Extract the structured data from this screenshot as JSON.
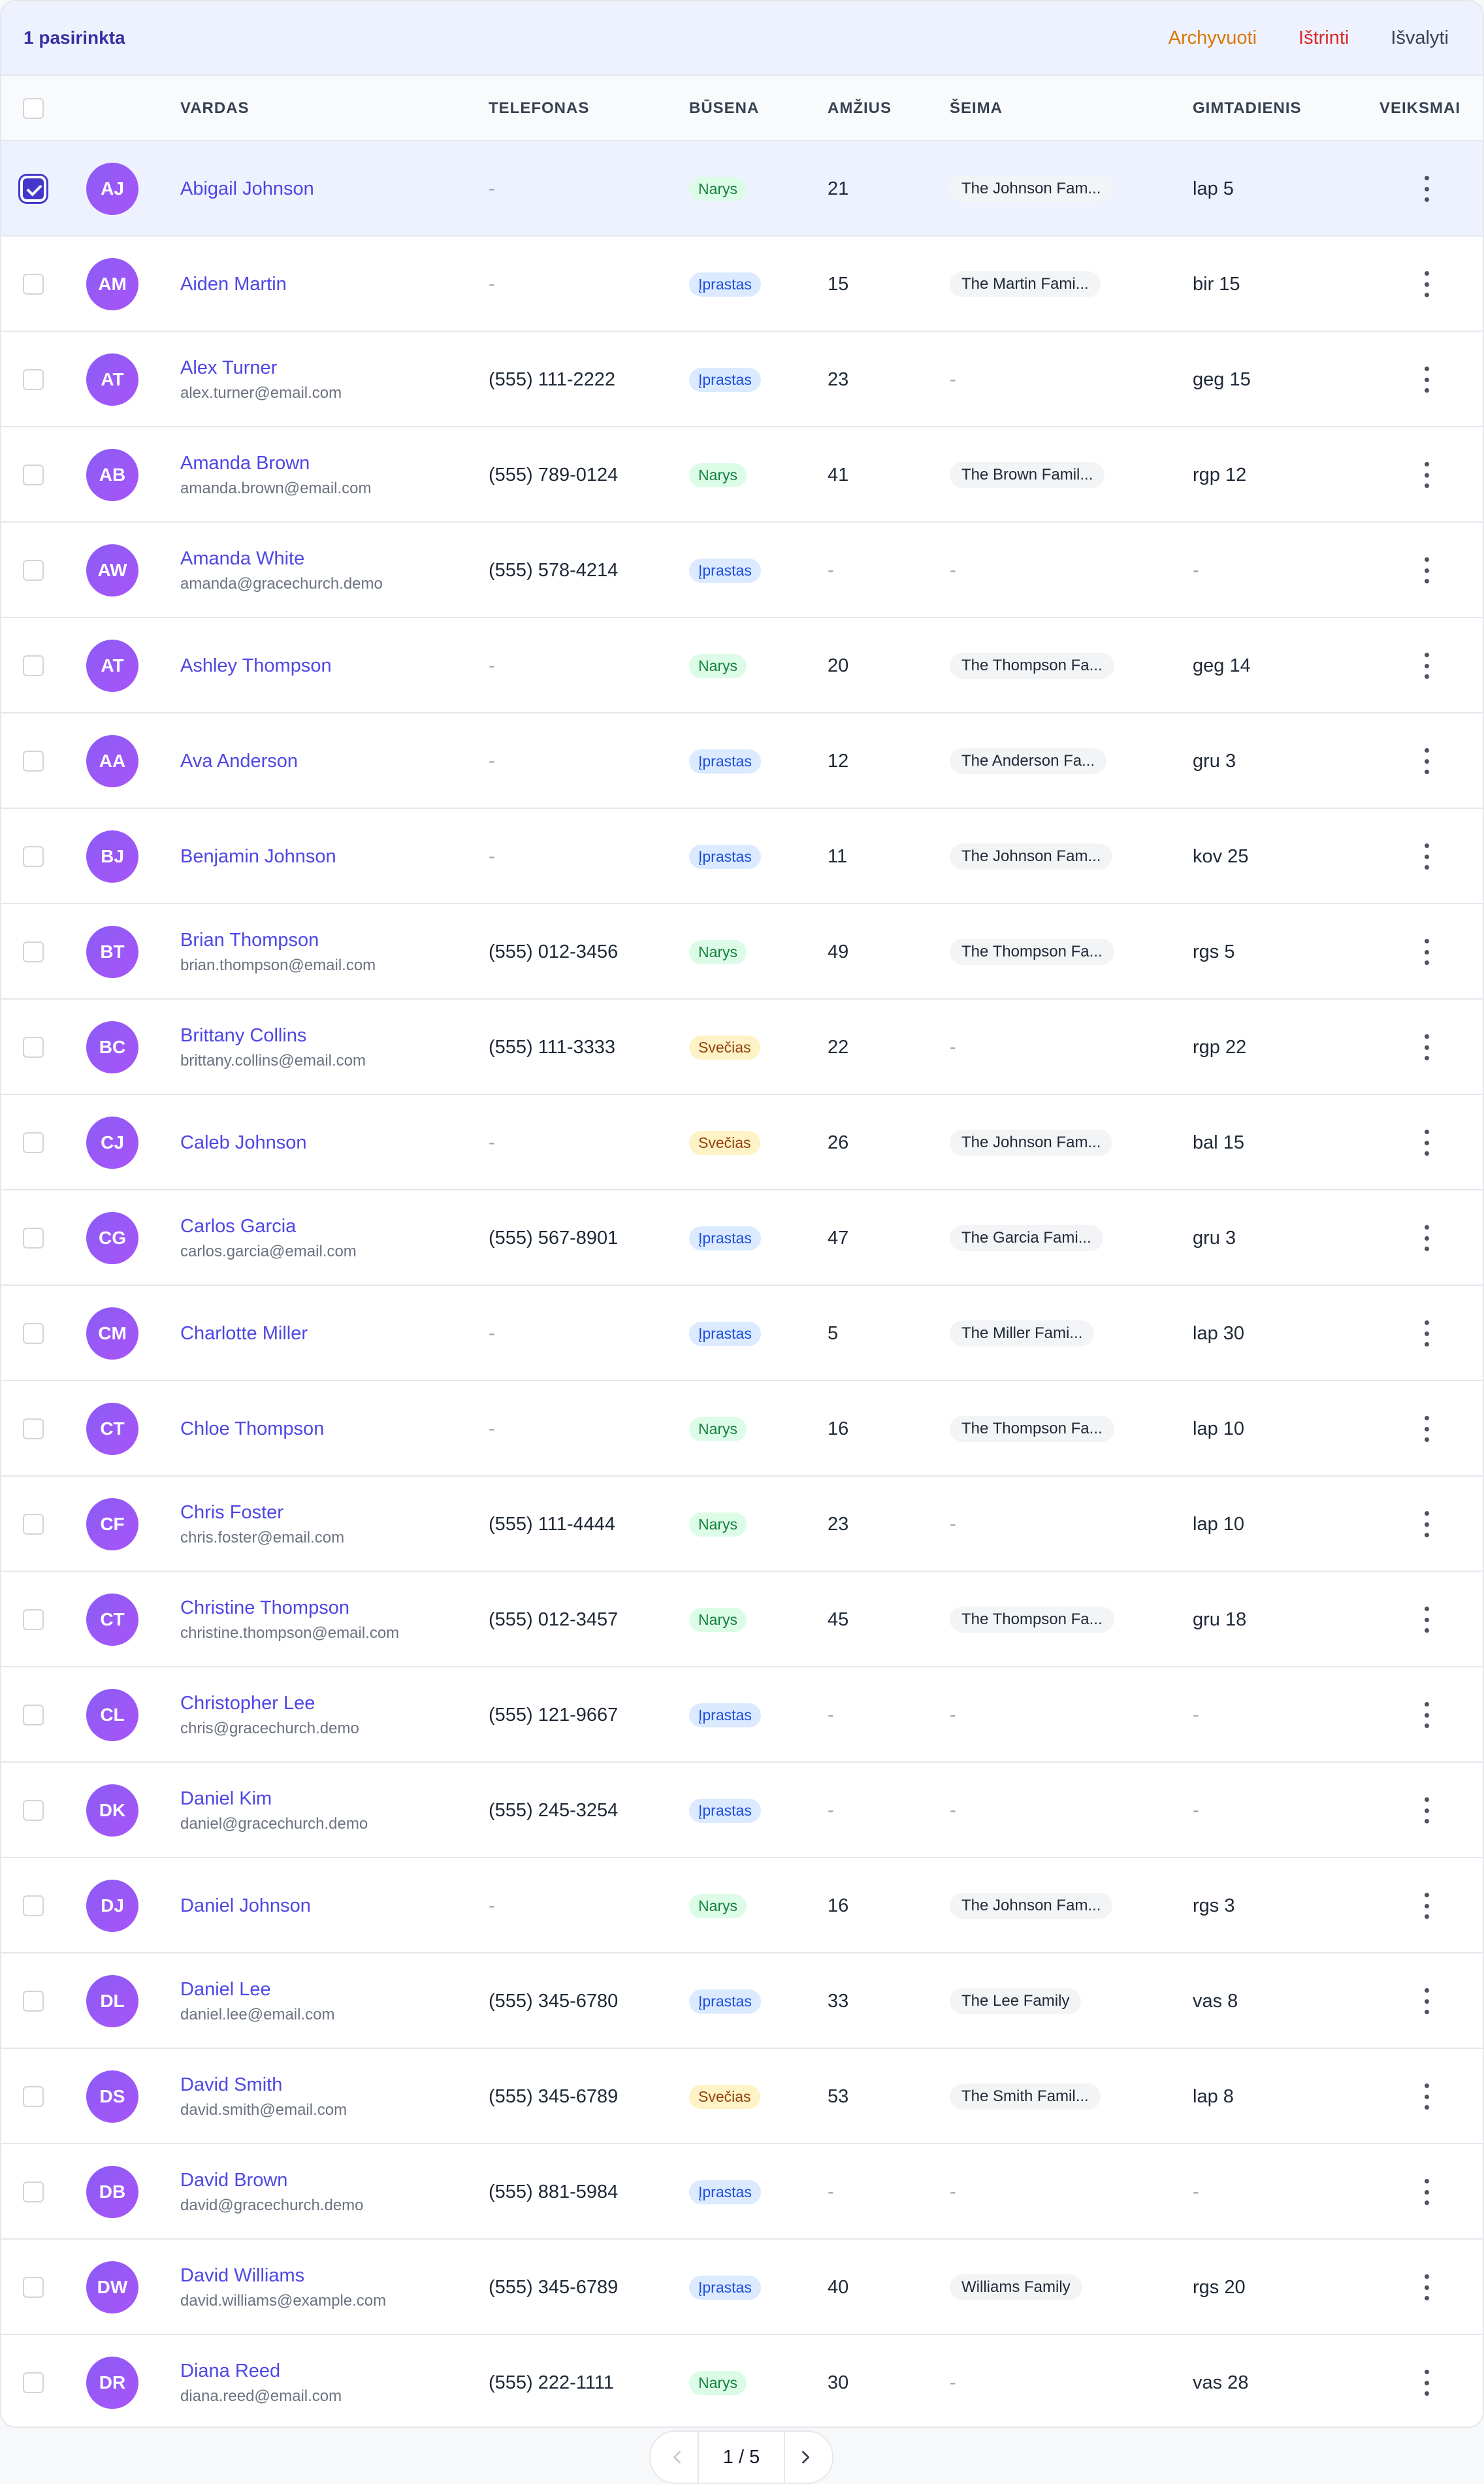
{
  "selection": {
    "count_label": "1 pasirinkta",
    "archive_label": "Archyvuoti",
    "delete_label": "Ištrinti",
    "clear_label": "Išvalyti"
  },
  "columns": {
    "name": "VARDAS",
    "phone": "TELEFONAS",
    "status": "BŪSENA",
    "age": "AMŽIUS",
    "family": "ŠEIMA",
    "birthday": "GIMTADIENIS",
    "actions": "VEIKSMAI"
  },
  "colors": {
    "accent": "#4f46e5",
    "avatar": "#8b5cf6",
    "member_badge": "#dcfce7",
    "regular_badge": "#dbeafe",
    "guest_badge": "#fef3c7"
  },
  "icons": {
    "row_actions": "kebab-vertical-icon",
    "prev_page": "chevron-left-icon",
    "next_page": "chevron-right-icon"
  },
  "rows": [
    {
      "initials": "AJ",
      "name": "Abigail Johnson",
      "email": "",
      "phone": "-",
      "status": "Narys",
      "status_type": "member",
      "age": "21",
      "family": "The Johnson Fam...",
      "birthday": "lap 5",
      "selected": true
    },
    {
      "initials": "AM",
      "name": "Aiden Martin",
      "email": "",
      "phone": "-",
      "status": "Įprastas",
      "status_type": "regular",
      "age": "15",
      "family": "The Martin Fami...",
      "birthday": "bir 15",
      "selected": false
    },
    {
      "initials": "AT",
      "name": "Alex Turner",
      "email": "alex.turner@email.com",
      "phone": "(555) 111-2222",
      "status": "Įprastas",
      "status_type": "regular",
      "age": "23",
      "family": "",
      "birthday": "geg 15",
      "selected": false
    },
    {
      "initials": "AB",
      "name": "Amanda Brown",
      "email": "amanda.brown@email.com",
      "phone": "(555) 789-0124",
      "status": "Narys",
      "status_type": "member",
      "age": "41",
      "family": "The Brown Famil...",
      "birthday": "rgp 12",
      "selected": false
    },
    {
      "initials": "AW",
      "name": "Amanda White",
      "email": "amanda@gracechurch.demo",
      "phone": "(555) 578-4214",
      "status": "Įprastas",
      "status_type": "regular",
      "age": "-",
      "family": "",
      "birthday": "-",
      "selected": false
    },
    {
      "initials": "AT",
      "name": "Ashley Thompson",
      "email": "",
      "phone": "-",
      "status": "Narys",
      "status_type": "member",
      "age": "20",
      "family": "The Thompson Fa...",
      "birthday": "geg 14",
      "selected": false
    },
    {
      "initials": "AA",
      "name": "Ava Anderson",
      "email": "",
      "phone": "-",
      "status": "Įprastas",
      "status_type": "regular",
      "age": "12",
      "family": "The Anderson Fa...",
      "birthday": "gru 3",
      "selected": false
    },
    {
      "initials": "BJ",
      "name": "Benjamin Johnson",
      "email": "",
      "phone": "-",
      "status": "Įprastas",
      "status_type": "regular",
      "age": "11",
      "family": "The Johnson Fam...",
      "birthday": "kov 25",
      "selected": false
    },
    {
      "initials": "BT",
      "name": "Brian Thompson",
      "email": "brian.thompson@email.com",
      "phone": "(555) 012-3456",
      "status": "Narys",
      "status_type": "member",
      "age": "49",
      "family": "The Thompson Fa...",
      "birthday": "rgs 5",
      "selected": false
    },
    {
      "initials": "BC",
      "name": "Brittany Collins",
      "email": "brittany.collins@email.com",
      "phone": "(555) 111-3333",
      "status": "Svečias",
      "status_type": "guest",
      "age": "22",
      "family": "",
      "birthday": "rgp 22",
      "selected": false
    },
    {
      "initials": "CJ",
      "name": "Caleb Johnson",
      "email": "",
      "phone": "-",
      "status": "Svečias",
      "status_type": "guest",
      "age": "26",
      "family": "The Johnson Fam...",
      "birthday": "bal 15",
      "selected": false
    },
    {
      "initials": "CG",
      "name": "Carlos Garcia",
      "email": "carlos.garcia@email.com",
      "phone": "(555) 567-8901",
      "status": "Įprastas",
      "status_type": "regular",
      "age": "47",
      "family": "The Garcia Fami...",
      "birthday": "gru 3",
      "selected": false
    },
    {
      "initials": "CM",
      "name": "Charlotte Miller",
      "email": "",
      "phone": "-",
      "status": "Įprastas",
      "status_type": "regular",
      "age": "5",
      "family": "The Miller Fami...",
      "birthday": "lap 30",
      "selected": false
    },
    {
      "initials": "CT",
      "name": "Chloe Thompson",
      "email": "",
      "phone": "-",
      "status": "Narys",
      "status_type": "member",
      "age": "16",
      "family": "The Thompson Fa...",
      "birthday": "lap 10",
      "selected": false
    },
    {
      "initials": "CF",
      "name": "Chris Foster",
      "email": "chris.foster@email.com",
      "phone": "(555) 111-4444",
      "status": "Narys",
      "status_type": "member",
      "age": "23",
      "family": "",
      "birthday": "lap 10",
      "selected": false
    },
    {
      "initials": "CT",
      "name": "Christine Thompson",
      "email": "christine.thompson@email.com",
      "phone": "(555) 012-3457",
      "status": "Narys",
      "status_type": "member",
      "age": "45",
      "family": "The Thompson Fa...",
      "birthday": "gru 18",
      "selected": false
    },
    {
      "initials": "CL",
      "name": "Christopher Lee",
      "email": "chris@gracechurch.demo",
      "phone": "(555) 121-9667",
      "status": "Įprastas",
      "status_type": "regular",
      "age": "-",
      "family": "",
      "birthday": "-",
      "selected": false
    },
    {
      "initials": "DK",
      "name": "Daniel Kim",
      "email": "daniel@gracechurch.demo",
      "phone": "(555) 245-3254",
      "status": "Įprastas",
      "status_type": "regular",
      "age": "-",
      "family": "",
      "birthday": "-",
      "selected": false
    },
    {
      "initials": "DJ",
      "name": "Daniel Johnson",
      "email": "",
      "phone": "-",
      "status": "Narys",
      "status_type": "member",
      "age": "16",
      "family": "The Johnson Fam...",
      "birthday": "rgs 3",
      "selected": false
    },
    {
      "initials": "DL",
      "name": "Daniel Lee",
      "email": "daniel.lee@email.com",
      "phone": "(555) 345-6780",
      "status": "Įprastas",
      "status_type": "regular",
      "age": "33",
      "family": "The Lee Family",
      "birthday": "vas 8",
      "selected": false
    },
    {
      "initials": "DS",
      "name": "David Smith",
      "email": "david.smith@email.com",
      "phone": "(555) 345-6789",
      "status": "Svečias",
      "status_type": "guest",
      "age": "53",
      "family": "The Smith Famil...",
      "birthday": "lap 8",
      "selected": false
    },
    {
      "initials": "DB",
      "name": "David Brown",
      "email": "david@gracechurch.demo",
      "phone": "(555) 881-5984",
      "status": "Įprastas",
      "status_type": "regular",
      "age": "-",
      "family": "",
      "birthday": "-",
      "selected": false
    },
    {
      "initials": "DW",
      "name": "David Williams",
      "email": "david.williams@example.com",
      "phone": "(555) 345-6789",
      "status": "Įprastas",
      "status_type": "regular",
      "age": "40",
      "family": "Williams Family",
      "birthday": "rgs 20",
      "selected": false
    },
    {
      "initials": "DR",
      "name": "Diana Reed",
      "email": "diana.reed@email.com",
      "phone": "(555) 222-1111",
      "status": "Narys",
      "status_type": "member",
      "age": "30",
      "family": "",
      "birthday": "vas 28",
      "selected": false
    }
  ],
  "pagination": {
    "label": "1 / 5"
  }
}
